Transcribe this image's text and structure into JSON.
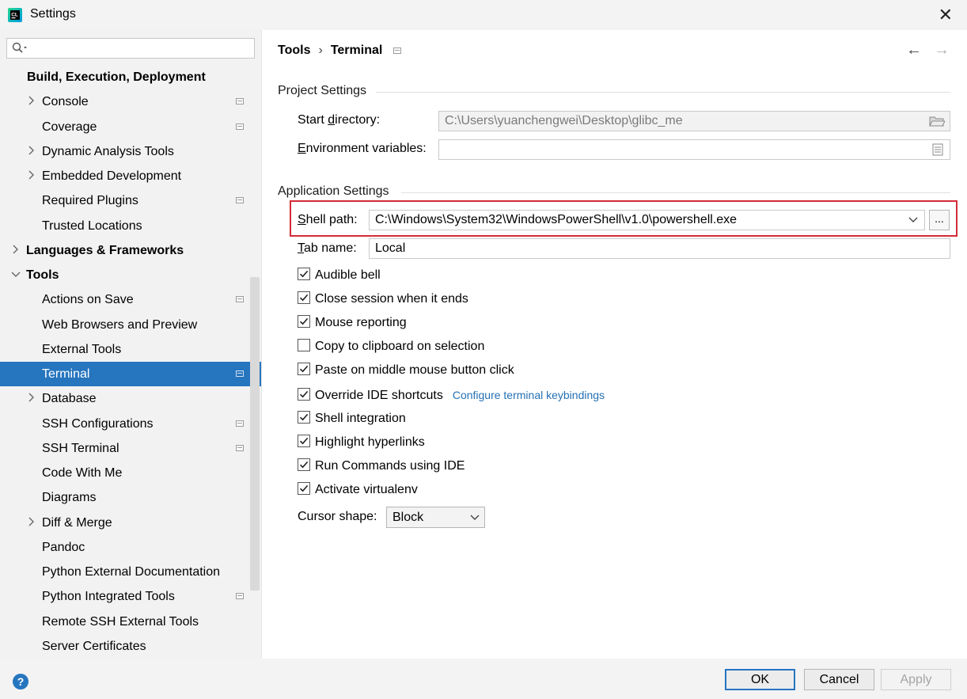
{
  "window": {
    "title": "Settings",
    "icon": "clion-app-icon",
    "close": "✕"
  },
  "search": {
    "value": ""
  },
  "sidebar": {
    "items": [
      {
        "label": "Build, Execution, Deployment",
        "bold": true,
        "indent": 0,
        "arrow": "",
        "project": false
      },
      {
        "label": "Console",
        "indent": 1,
        "arrow": "right",
        "project": true
      },
      {
        "label": "Coverage",
        "indent": 1,
        "arrow": "",
        "project": true
      },
      {
        "label": "Dynamic Analysis Tools",
        "indent": 1,
        "arrow": "right",
        "project": false
      },
      {
        "label": "Embedded Development",
        "indent": 1,
        "arrow": "right",
        "project": false
      },
      {
        "label": "Required Plugins",
        "indent": 1,
        "arrow": "",
        "project": true
      },
      {
        "label": "Trusted Locations",
        "indent": 1,
        "arrow": "",
        "project": false
      },
      {
        "label": "Languages & Frameworks",
        "bold": true,
        "indent": 0,
        "arrow": "right",
        "project": false
      },
      {
        "label": "Tools",
        "bold": true,
        "indent": 0,
        "arrow": "down",
        "project": false
      },
      {
        "label": "Actions on Save",
        "indent": 1,
        "arrow": "",
        "project": true
      },
      {
        "label": "Web Browsers and Preview",
        "indent": 1,
        "arrow": "",
        "project": false
      },
      {
        "label": "External Tools",
        "indent": 1,
        "arrow": "",
        "project": false
      },
      {
        "label": "Terminal",
        "indent": 1,
        "arrow": "",
        "project": true,
        "selected": true
      },
      {
        "label": "Database",
        "indent": 1,
        "arrow": "right",
        "project": false
      },
      {
        "label": "SSH Configurations",
        "indent": 1,
        "arrow": "",
        "project": true
      },
      {
        "label": "SSH Terminal",
        "indent": 1,
        "arrow": "",
        "project": true
      },
      {
        "label": "Code With Me",
        "indent": 1,
        "arrow": "",
        "project": false
      },
      {
        "label": "Diagrams",
        "indent": 1,
        "arrow": "",
        "project": false
      },
      {
        "label": "Diff & Merge",
        "indent": 1,
        "arrow": "right",
        "project": false
      },
      {
        "label": "Pandoc",
        "indent": 1,
        "arrow": "",
        "project": false
      },
      {
        "label": "Python External Documentation",
        "indent": 1,
        "arrow": "",
        "project": false
      },
      {
        "label": "Python Integrated Tools",
        "indent": 1,
        "arrow": "",
        "project": true
      },
      {
        "label": "Remote SSH External Tools",
        "indent": 1,
        "arrow": "",
        "project": false
      },
      {
        "label": "Server Certificates",
        "indent": 1,
        "arrow": "",
        "project": false
      }
    ]
  },
  "breadcrumb": {
    "parent": "Tools",
    "separator": "›",
    "current": "Terminal"
  },
  "nav": {
    "back": "←",
    "forward": "→"
  },
  "project_settings": {
    "heading": "Project Settings",
    "start_directory": {
      "label_pre": "Start ",
      "label_mnemonic": "d",
      "label_post": "irectory:",
      "value": "C:\\Users\\yuanchengwei\\Desktop\\glibc_me"
    },
    "env_vars": {
      "label_mnemonic": "E",
      "label_post": "nvironment variables:",
      "value": ""
    }
  },
  "app_settings": {
    "heading": "Application Settings",
    "shell_path": {
      "label_mnemonic": "S",
      "label_post": "hell path:",
      "value": "C:\\Windows\\System32\\WindowsPowerShell\\v1.0\\powershell.exe",
      "browse": "..."
    },
    "tab_name": {
      "label_mnemonic": "T",
      "label_post": "ab name:",
      "value": "Local"
    },
    "checkboxes": [
      {
        "label": "Audible bell",
        "checked": true
      },
      {
        "label": "Close session when it ends",
        "checked": true
      },
      {
        "label": "Mouse reporting",
        "checked": true
      },
      {
        "label": "Copy to clipboard on selection",
        "checked": false
      },
      {
        "label": "Paste on middle mouse button click",
        "checked": true
      },
      {
        "label": "Override IDE shortcuts",
        "checked": true,
        "link": "Configure terminal keybindings"
      },
      {
        "label": "Shell integration",
        "checked": true
      },
      {
        "label": "Highlight hyperlinks",
        "checked": true
      },
      {
        "label": "Run Commands using IDE",
        "checked": true
      },
      {
        "label": "Activate virtualenv",
        "checked": true
      }
    ],
    "cursor_shape": {
      "label": "Cursor shape:",
      "value": "Block"
    }
  },
  "footer": {
    "ok": "OK",
    "cancel": "Cancel",
    "apply": "Apply",
    "help": "?"
  },
  "colors": {
    "accent": "#2675bf",
    "highlight_border": "#d42b38",
    "link": "#2470b3",
    "sidebar_bg": "#f2f2f2"
  }
}
